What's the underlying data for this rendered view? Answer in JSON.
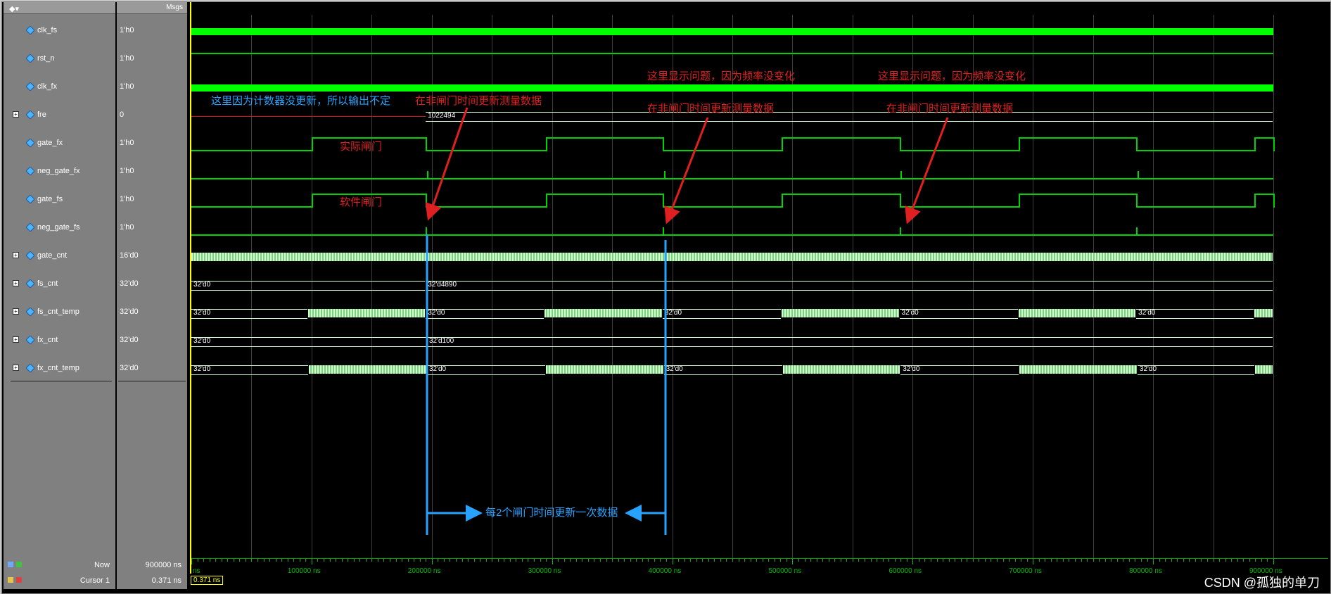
{
  "header": {
    "msgs_label": "Msgs",
    "menu_icon": "wave-menu-icon"
  },
  "signals": [
    {
      "name": "clk_fs",
      "value": "1'h0",
      "expandable": false
    },
    {
      "name": "rst_n",
      "value": "1'h0",
      "expandable": false
    },
    {
      "name": "clk_fx",
      "value": "1'h0",
      "expandable": false
    },
    {
      "name": "fre",
      "value": "0",
      "expandable": true
    },
    {
      "name": "gate_fx",
      "value": "1'h0",
      "expandable": false
    },
    {
      "name": "neg_gate_fx",
      "value": "1'h0",
      "expandable": false
    },
    {
      "name": "gate_fs",
      "value": "1'h0",
      "expandable": false
    },
    {
      "name": "neg_gate_fs",
      "value": "1'h0",
      "expandable": false
    },
    {
      "name": "gate_cnt",
      "value": "16'd0",
      "expandable": true
    },
    {
      "name": "fs_cnt",
      "value": "32'd0",
      "expandable": true
    },
    {
      "name": "fs_cnt_temp",
      "value": "32'd0",
      "expandable": true
    },
    {
      "name": "fx_cnt",
      "value": "32'd0",
      "expandable": true
    },
    {
      "name": "fx_cnt_temp",
      "value": "32'd0",
      "expandable": true
    }
  ],
  "bus_values": {
    "fre_after": "1022494",
    "fs_cnt_before": "32'd0",
    "fs_cnt_after": "32'd4890",
    "temp": "32'd0",
    "fx_cnt_before": "32'd0",
    "fx_cnt_after": "32'd100"
  },
  "annotations": {
    "counter_not_updated": "这里因为计数器没更新，所以输出不定",
    "update_in_non_gate": "在非闸门时间更新测量数据",
    "display_issue": "这里显示问题，因为频率没变化",
    "actual_gate": "实际闸门",
    "software_gate": "软件闸门",
    "every_two_gates": "每2个闸门时间更新一次数据"
  },
  "status": {
    "now_label": "Now",
    "now_value": "900000 ns",
    "cursor_label": "Cursor 1",
    "cursor_value": "0.371 ns",
    "cursor_box": "0.371 ns"
  },
  "ruler": {
    "labels": [
      "ns",
      "100000 ns",
      "200000 ns",
      "300000 ns",
      "400000 ns",
      "500000 ns",
      "600000 ns",
      "700000 ns",
      "800000 ns",
      "900000 ns"
    ]
  },
  "watermark": "CSDN @孤独的单刀",
  "colors": {
    "wave": "#00d400",
    "annotation_red": "#e02020",
    "annotation_blue": "#27a3ff",
    "cursor": "#ffff00"
  }
}
